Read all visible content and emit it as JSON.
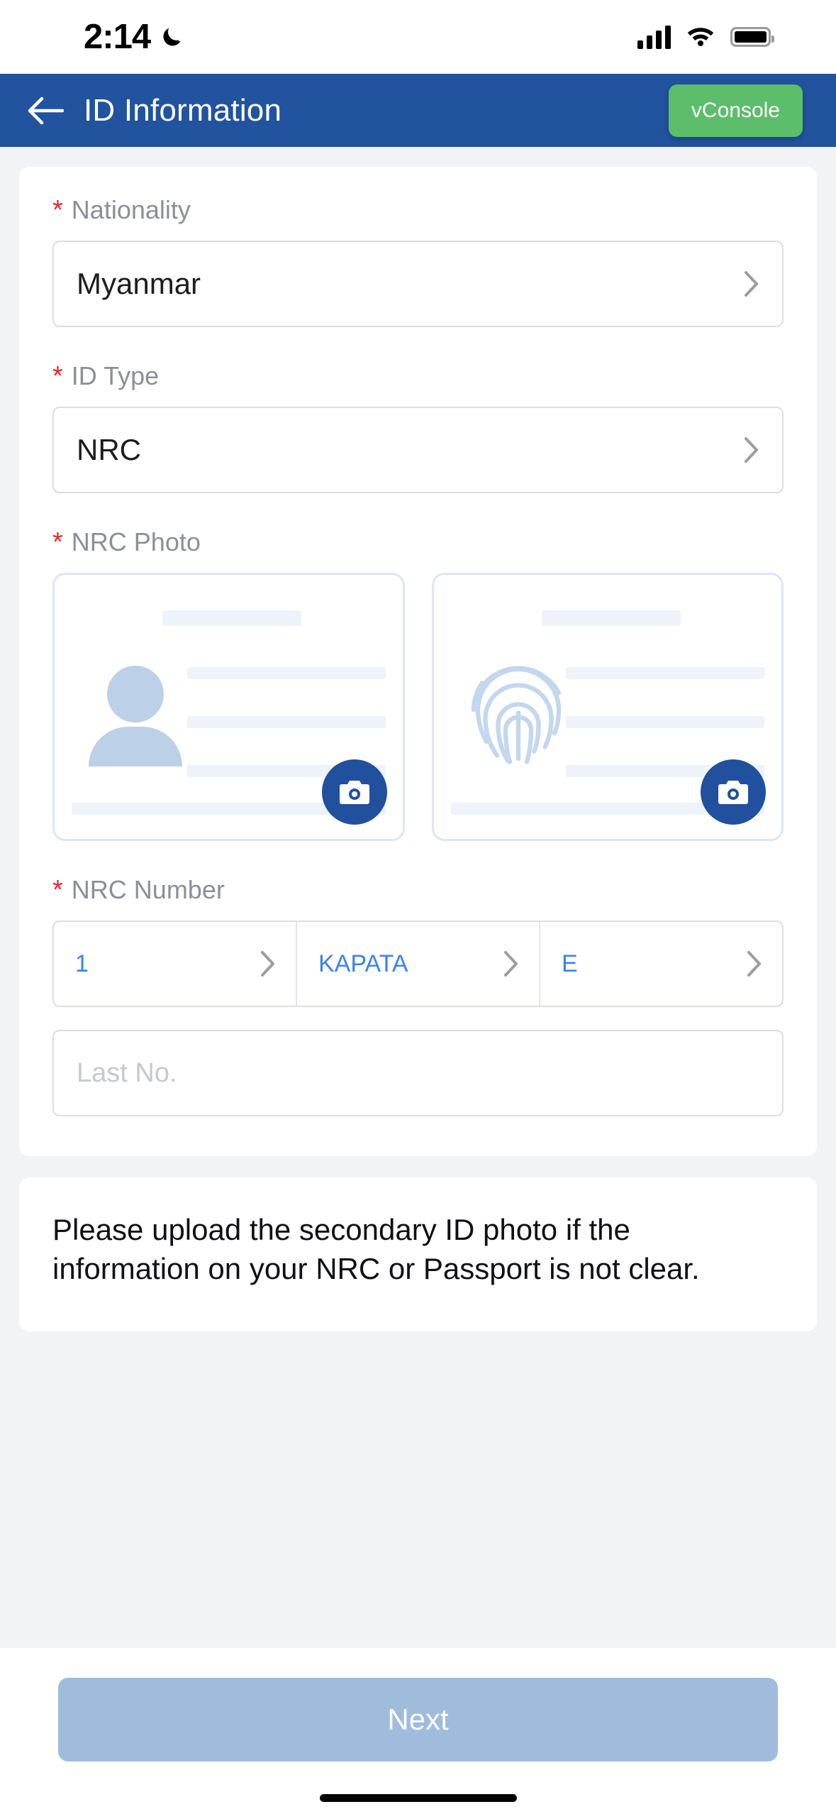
{
  "status_bar": {
    "time": "2:14",
    "dnd_icon": "crescent-moon-icon",
    "signal_icon": "cellular-signal-icon",
    "wifi_icon": "wifi-icon",
    "battery_icon": "battery-icon"
  },
  "header": {
    "back_icon": "back-arrow-icon",
    "title": "ID Information",
    "vconsole_label": "vConsole",
    "bg_color": "#21539f",
    "vconsole_color": "#5cbd6b"
  },
  "form": {
    "nationality": {
      "label": "Nationality",
      "required_mark": "*",
      "value": "Myanmar",
      "chevron_icon": "chevron-right-icon"
    },
    "id_type": {
      "label": "ID Type",
      "required_mark": "*",
      "value": "NRC",
      "chevron_icon": "chevron-right-icon"
    },
    "nrc_photo": {
      "label": "NRC Photo",
      "required_mark": "*",
      "front": {
        "placeholder_icon": "person-avatar-icon",
        "camera_icon": "camera-icon"
      },
      "back": {
        "placeholder_icon": "fingerprint-icon",
        "camera_icon": "camera-icon"
      }
    },
    "nrc_number": {
      "label": "NRC Number",
      "required_mark": "*",
      "segments": [
        {
          "value": "1",
          "chevron_icon": "chevron-right-icon"
        },
        {
          "value": "KAPATA",
          "chevron_icon": "chevron-right-icon"
        },
        {
          "value": "E",
          "chevron_icon": "chevron-right-icon"
        }
      ],
      "last_no_placeholder": "Last No.",
      "last_no_value": "",
      "value_color": "#3b82f6"
    }
  },
  "notice": {
    "text": "Please upload the secondary ID photo if the information on your NRC or Passport is not clear."
  },
  "footer": {
    "next_label": "Next",
    "next_color": "#9fbcdd"
  }
}
